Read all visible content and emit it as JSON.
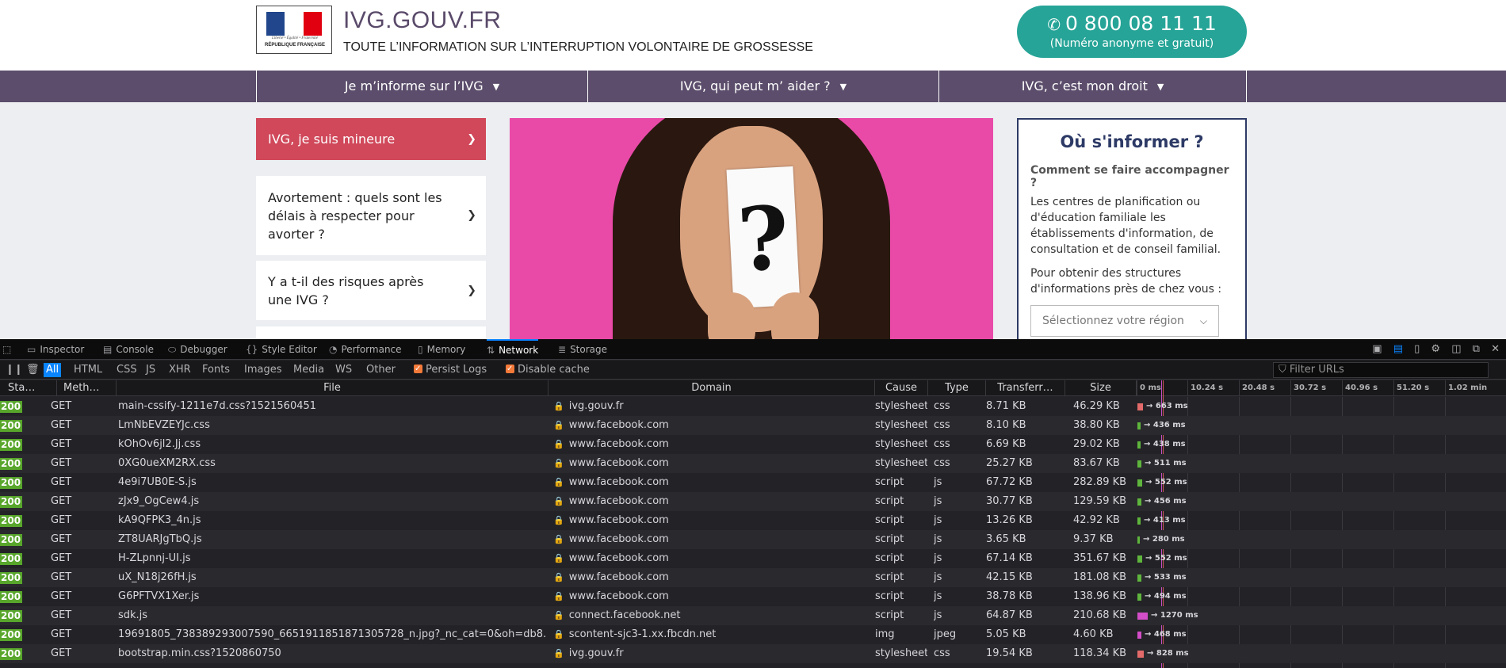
{
  "site": {
    "logo": {
      "motto": "Liberté • Égalité • Fraternité",
      "republic": "RÉPUBLIQUE FRANÇAISE"
    },
    "title": "IVG.GOUV.FR",
    "tagline": "TOUTE L’INFORMATION SUR L’INTERRUPTION VOLONTAIRE DE GROSSESSE",
    "phone": {
      "number": "0 800 08 11 11",
      "note": "(Numéro anonyme et gratuit)",
      "icon": "phone-icon",
      "color": "#26a497"
    },
    "nav_color": "#5b4d6b",
    "nav": [
      {
        "label": "Je m’informe sur l’IVG"
      },
      {
        "label": "IVG, qui peut m’ aider ?"
      },
      {
        "label": "IVG, c’est mon droit"
      }
    ],
    "side_cards": [
      {
        "label": "IVG, je suis mineure",
        "active": true
      },
      {
        "label": "Avortement : quels sont les délais à respecter pour avorter ?",
        "active": false
      },
      {
        "label": "Y a t-il des risques après une IVG ?",
        "active": false
      },
      {
        "label": "",
        "active": false
      }
    ],
    "active_card_color": "#d0485a",
    "hero": {
      "symbol": "?",
      "bg": "#e94aa8"
    },
    "info_box": {
      "title": "Où s'informer ?",
      "question": "Comment se faire accompagner ?",
      "text1": "Les centres de planification ou d'éducation familiale les établissements d'information, de consultation et de conseil familial.",
      "text2": "Pour obtenir des structures d'informations près de chez vous :",
      "select_placeholder": "Sélectionnez votre région"
    }
  },
  "devtools": {
    "tabs": [
      {
        "label": "Inspector",
        "icon": "inspector-icon",
        "glyph": "▭"
      },
      {
        "label": "Console",
        "icon": "console-icon",
        "glyph": "▤"
      },
      {
        "label": "Debugger",
        "icon": "debugger-icon",
        "glyph": "⬭"
      },
      {
        "label": "Style Editor",
        "icon": "style-editor-icon",
        "glyph": "{}"
      },
      {
        "label": "Performance",
        "icon": "performance-icon",
        "glyph": "◔"
      },
      {
        "label": "Memory",
        "icon": "memory-icon",
        "glyph": "▯"
      },
      {
        "label": "Network",
        "icon": "network-icon",
        "glyph": "⇅",
        "active": true
      },
      {
        "label": "Storage",
        "icon": "storage-icon",
        "glyph": "≣"
      }
    ],
    "filters": [
      "All",
      "HTML",
      "CSS",
      "JS",
      "XHR",
      "Fonts",
      "Images",
      "Media",
      "WS",
      "Other"
    ],
    "active_filter": "All",
    "persist_logs": "Persist Logs",
    "disable_cache": "Disable cache",
    "filter_placeholder": "Filter URLs",
    "columns": [
      "Sta…",
      "Meth…",
      "File",
      "Domain",
      "Cause",
      "Type",
      "Transferr…",
      "Size"
    ],
    "timeline_ticks": [
      "0 ms",
      "10.24 s",
      "20.48 s",
      "30.72 s",
      "40.96 s",
      "51.20 s",
      "1.02 min"
    ],
    "requests": [
      {
        "status": "200",
        "method": "GET",
        "file": "main-cssify-1211e7d.css?1521560451",
        "domain": "ivg.gouv.fr",
        "cause": "stylesheet",
        "type": "css",
        "transferred": "8.71 KB",
        "size": "46.29 KB",
        "time": "663 ms",
        "wf_color": "#e36a6a"
      },
      {
        "status": "200",
        "method": "GET",
        "file": "LmNbEVZEYJc.css",
        "domain": "www.facebook.com",
        "cause": "stylesheet",
        "type": "css",
        "transferred": "8.10 KB",
        "size": "38.80 KB",
        "time": "436 ms",
        "wf_color": "#5fb53d"
      },
      {
        "status": "200",
        "method": "GET",
        "file": "kOhOv6jl2.Jj.css",
        "domain": "www.facebook.com",
        "cause": "stylesheet",
        "type": "css",
        "transferred": "6.69 KB",
        "size": "29.02 KB",
        "time": "438 ms",
        "wf_color": "#5fb53d"
      },
      {
        "status": "200",
        "method": "GET",
        "file": "0XG0ueXM2RX.css",
        "domain": "www.facebook.com",
        "cause": "stylesheet",
        "type": "css",
        "transferred": "25.27 KB",
        "size": "83.67 KB",
        "time": "511 ms",
        "wf_color": "#5fb53d"
      },
      {
        "status": "200",
        "method": "GET",
        "file": "4e9i7UB0E-S.js",
        "domain": "www.facebook.com",
        "cause": "script",
        "type": "js",
        "transferred": "67.72 KB",
        "size": "282.89 KB",
        "time": "552 ms",
        "wf_color": "#5fb53d"
      },
      {
        "status": "200",
        "method": "GET",
        "file": "zJx9_OgCew4.js",
        "domain": "www.facebook.com",
        "cause": "script",
        "type": "js",
        "transferred": "30.77 KB",
        "size": "129.59 KB",
        "time": "456 ms",
        "wf_color": "#5fb53d"
      },
      {
        "status": "200",
        "method": "GET",
        "file": "kA9QFPK3_4n.js",
        "domain": "www.facebook.com",
        "cause": "script",
        "type": "js",
        "transferred": "13.26 KB",
        "size": "42.92 KB",
        "time": "413 ms",
        "wf_color": "#5fb53d"
      },
      {
        "status": "200",
        "method": "GET",
        "file": "ZT8UARJgTbQ.js",
        "domain": "www.facebook.com",
        "cause": "script",
        "type": "js",
        "transferred": "3.65 KB",
        "size": "9.37 KB",
        "time": "280 ms",
        "wf_color": "#5fb53d"
      },
      {
        "status": "200",
        "method": "GET",
        "file": "H-ZLpnnj-UI.js",
        "domain": "www.facebook.com",
        "cause": "script",
        "type": "js",
        "transferred": "67.14 KB",
        "size": "351.67 KB",
        "time": "552 ms",
        "wf_color": "#5fb53d"
      },
      {
        "status": "200",
        "method": "GET",
        "file": "uX_N18j26fH.js",
        "domain": "www.facebook.com",
        "cause": "script",
        "type": "js",
        "transferred": "42.15 KB",
        "size": "181.08 KB",
        "time": "533 ms",
        "wf_color": "#5fb53d"
      },
      {
        "status": "200",
        "method": "GET",
        "file": "G6PFTVX1Xer.js",
        "domain": "www.facebook.com",
        "cause": "script",
        "type": "js",
        "transferred": "38.78 KB",
        "size": "138.96 KB",
        "time": "494 ms",
        "wf_color": "#5fb53d"
      },
      {
        "status": "200",
        "method": "GET",
        "file": "sdk.js",
        "domain": "connect.facebook.net",
        "cause": "script",
        "type": "js",
        "transferred": "64.87 KB",
        "size": "210.68 KB",
        "time": "1270 ms",
        "wf_color": "#d34ec8"
      },
      {
        "status": "200",
        "method": "GET",
        "file": "19691805_738389293007590_6651911851871305728_n.jpg?_nc_cat=0&oh=db8…",
        "domain": "scontent-sjc3-1.xx.fbcdn.net",
        "cause": "img",
        "type": "jpeg",
        "transferred": "5.05 KB",
        "size": "4.60 KB",
        "time": "468 ms",
        "wf_color": "#d34ec8"
      },
      {
        "status": "200",
        "method": "GET",
        "file": "bootstrap.min.css?1520860750",
        "domain": "ivg.gouv.fr",
        "cause": "stylesheet",
        "type": "css",
        "transferred": "19.54 KB",
        "size": "118.34 KB",
        "time": "828 ms",
        "wf_color": "#e36a6a"
      }
    ]
  }
}
